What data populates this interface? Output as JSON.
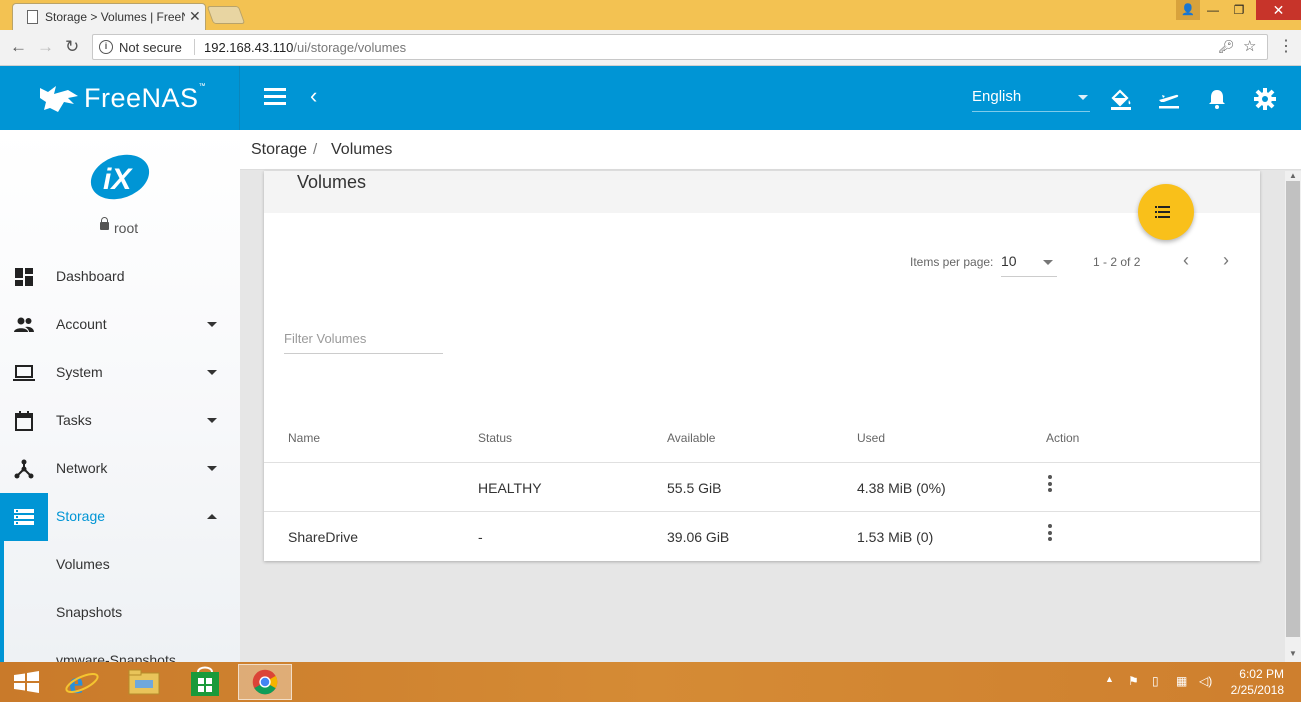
{
  "browser": {
    "tab_title": "Storage > Volumes | FreeNAS",
    "security_label": "Not secure",
    "url_host": "192.168.43.110",
    "url_path": "/ui/storage/volumes"
  },
  "header": {
    "brand": "FreeNAS",
    "brand_tm": "™",
    "language": "English"
  },
  "breadcrumb": {
    "parent": "Storage",
    "separator": "/",
    "current": "Volumes"
  },
  "sidebar": {
    "user": "root",
    "items": [
      {
        "label": "Dashboard",
        "icon": "dashboard-icon"
      },
      {
        "label": "Account",
        "icon": "people-icon"
      },
      {
        "label": "System",
        "icon": "laptop-icon"
      },
      {
        "label": "Tasks",
        "icon": "calendar-icon"
      },
      {
        "label": "Network",
        "icon": "network-icon"
      },
      {
        "label": "Storage",
        "icon": "storage-icon"
      }
    ],
    "subitems": [
      {
        "label": "Volumes"
      },
      {
        "label": "Snapshots"
      },
      {
        "label": "vmware-Snapshots"
      }
    ]
  },
  "card": {
    "title": "Volumes",
    "items_per_page_label": "Items per page:",
    "items_per_page": "10",
    "range": "1 - 2 of 2",
    "filter_placeholder": "Filter Volumes"
  },
  "table": {
    "columns": [
      "Name",
      "Status",
      "Available",
      "Used",
      "Action"
    ],
    "rows": [
      {
        "name": "",
        "status": "HEALTHY",
        "available": "55.5 GiB",
        "used": "4.38 MiB (0%)"
      },
      {
        "name": "ShareDrive",
        "status": "-",
        "available": "39.06 GiB",
        "used": "1.53 MiB (0)"
      }
    ]
  },
  "taskbar": {
    "time": "6:02 PM",
    "date": "2/25/2018"
  },
  "colors": {
    "brand_blue": "#0095d5",
    "fab_yellow": "#f9c01a",
    "tabbar": "#f3c252"
  }
}
